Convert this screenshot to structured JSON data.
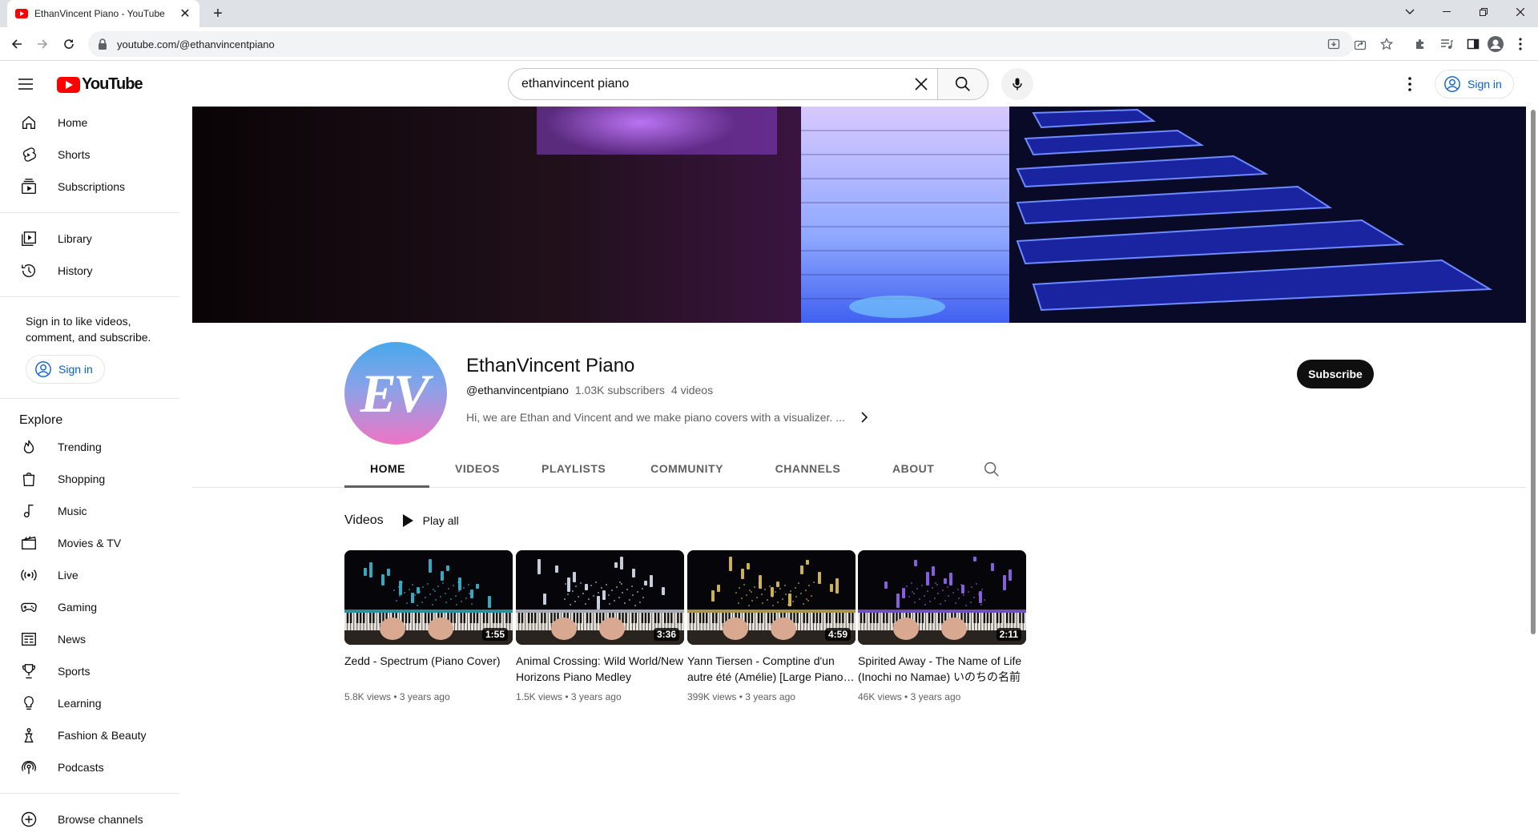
{
  "browser": {
    "tab_title": "EthanVincent Piano - YouTube",
    "url": "youtube.com/@ethanvincentpiano"
  },
  "masthead": {
    "logo_text": "YouTube",
    "search_value": "ethanvincent piano",
    "sign_in_label": "Sign in"
  },
  "sidebar": {
    "primary": [
      {
        "label": "Home",
        "icon": "home-icon"
      },
      {
        "label": "Shorts",
        "icon": "shorts-icon"
      },
      {
        "label": "Subscriptions",
        "icon": "subscriptions-icon"
      }
    ],
    "library": [
      {
        "label": "Library",
        "icon": "library-icon"
      },
      {
        "label": "History",
        "icon": "history-icon"
      }
    ],
    "sign_in_prompt": "Sign in to like videos, comment, and subscribe.",
    "sign_in_label": "Sign in",
    "explore_heading": "Explore",
    "explore": [
      {
        "label": "Trending",
        "icon": "trending-icon"
      },
      {
        "label": "Shopping",
        "icon": "shopping-icon"
      },
      {
        "label": "Music",
        "icon": "music-icon"
      },
      {
        "label": "Movies & TV",
        "icon": "movies-icon"
      },
      {
        "label": "Live",
        "icon": "live-icon"
      },
      {
        "label": "Gaming",
        "icon": "gaming-icon"
      },
      {
        "label": "News",
        "icon": "news-icon"
      },
      {
        "label": "Sports",
        "icon": "sports-icon"
      },
      {
        "label": "Learning",
        "icon": "learning-icon"
      },
      {
        "label": "Fashion & Beauty",
        "icon": "fashion-icon"
      },
      {
        "label": "Podcasts",
        "icon": "podcasts-icon"
      }
    ],
    "browse_channels": "Browse channels"
  },
  "channel": {
    "avatar_text": "EV",
    "name": "EthanVincent Piano",
    "handle": "@ethanvincentpiano",
    "subscribers": "1.03K subscribers",
    "video_count": "4 videos",
    "description": "Hi, we are Ethan and Vincent and we make piano covers with a visualizer. ...",
    "subscribe_label": "Subscribe"
  },
  "tabs": [
    "HOME",
    "VIDEOS",
    "PLAYLISTS",
    "COMMUNITY",
    "CHANNELS",
    "ABOUT"
  ],
  "active_tab": "HOME",
  "shelf": {
    "title": "Videos",
    "play_all": "Play all",
    "videos": [
      {
        "title": "Zedd - Spectrum (Piano Cover)",
        "duration": "1:55",
        "views": "5.8K views",
        "age": "3 years ago",
        "accent": "#3ec6e0"
      },
      {
        "title": "Animal Crossing: Wild World/New Horizons Piano Medley",
        "duration": "3:36",
        "views": "1.5K views",
        "age": "3 years ago",
        "accent": "#e8f0ff"
      },
      {
        "title": "Yann Tiersen - Comptine d'un autre été (Amélie) [Large Piano Cover]",
        "duration": "4:59",
        "views": "399K views",
        "age": "3 years ago",
        "accent": "#f0d060"
      },
      {
        "title": "Spirited Away - The Name of Life (Inochi no Namae) いのちの名前",
        "duration": "2:11",
        "views": "46K views",
        "age": "3 years ago",
        "accent": "#a070ff"
      }
    ]
  }
}
